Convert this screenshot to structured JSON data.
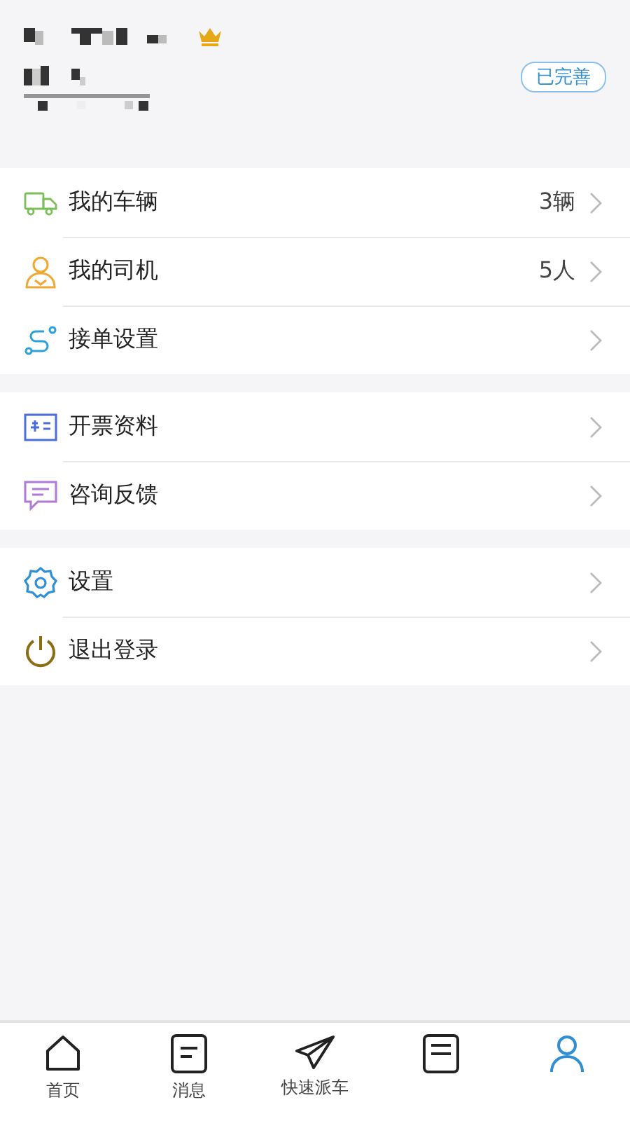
{
  "profile": {
    "status_badge": "已完善"
  },
  "menu_groups": [
    {
      "items": [
        {
          "label": "我的车辆",
          "value": "3辆"
        },
        {
          "label": "我的司机",
          "value": "5人"
        },
        {
          "label": "接单设置"
        }
      ]
    },
    {
      "items": [
        {
          "label": "开票资料"
        },
        {
          "label": "咨询反馈"
        }
      ]
    },
    {
      "items": [
        {
          "label": "设置"
        },
        {
          "label": "退出登录"
        }
      ]
    }
  ],
  "tab_bar": [
    {
      "label": "首页",
      "selected": false
    },
    {
      "label": "消息",
      "selected": false
    },
    {
      "label": "快速派车",
      "selected": false
    },
    {
      "selected": false
    },
    {
      "selected": true
    }
  ]
}
